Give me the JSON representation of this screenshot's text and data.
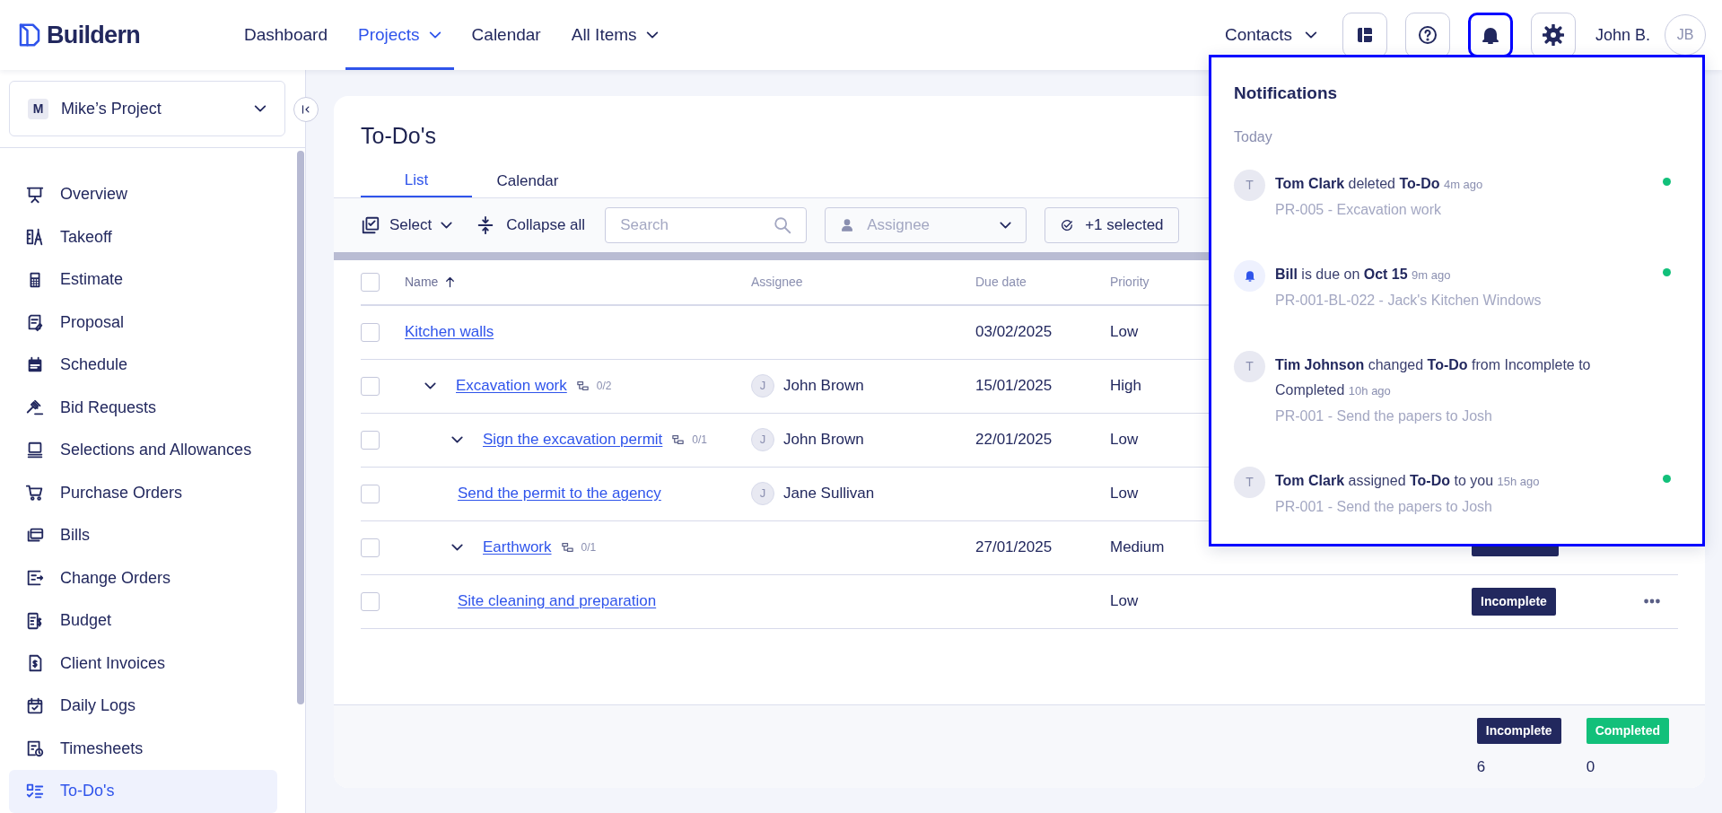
{
  "app": {
    "logo": "Buildern"
  },
  "nav": [
    {
      "label": "Dashboard",
      "selected": false,
      "dropdown": false
    },
    {
      "label": "Projects",
      "selected": true,
      "dropdown": true
    },
    {
      "label": "Calendar",
      "selected": false,
      "dropdown": false
    },
    {
      "label": "All Items",
      "selected": false,
      "dropdown": true
    }
  ],
  "header_right": {
    "contacts": "Contacts",
    "tools": [
      {
        "kind": "layout",
        "selected": false
      },
      {
        "kind": "help",
        "selected": false
      },
      {
        "kind": "notifications",
        "selected": true
      },
      {
        "kind": "settings",
        "selected": false
      }
    ],
    "user_name": "John B.",
    "user_initials": "JB"
  },
  "project": {
    "initial": "M",
    "name": "Mike’s Project"
  },
  "sidebar": {
    "items": [
      {
        "label": "Overview",
        "selected": false
      },
      {
        "label": "Takeoff",
        "selected": false
      },
      {
        "label": "Estimate",
        "selected": false
      },
      {
        "label": "Proposal",
        "selected": false
      },
      {
        "label": "Schedule",
        "selected": false
      },
      {
        "label": "Bid Requests",
        "selected": false
      },
      {
        "label": "Selections and Allowances",
        "selected": false
      },
      {
        "label": "Purchase Orders",
        "selected": false
      },
      {
        "label": "Bills",
        "selected": false
      },
      {
        "label": "Change Orders",
        "selected": false
      },
      {
        "label": "Budget",
        "selected": false
      },
      {
        "label": "Client Invoices",
        "selected": false
      },
      {
        "label": "Daily Logs",
        "selected": false
      },
      {
        "label": "Timesheets",
        "selected": false
      },
      {
        "label": "To-Do's",
        "selected": true
      }
    ]
  },
  "page": {
    "title": "To-Do's",
    "tabs": [
      {
        "label": "List",
        "selected": true
      },
      {
        "label": "Calendar",
        "selected": false
      }
    ],
    "toolbar": {
      "select": "Select",
      "collapse": "Collapse all",
      "search_placeholder": "Search",
      "assignee_placeholder": "Assignee",
      "status_filter": "+1 selected"
    },
    "table": {
      "select_all_checked": false,
      "columns": [
        {
          "label": "Name",
          "sorted": true
        },
        {
          "label": "Assignee",
          "sorted": false
        },
        {
          "label": "Due date",
          "sorted": false
        },
        {
          "label": "Priority",
          "sorted": false
        }
      ],
      "rows": [
        {
          "name": "Kitchen walls",
          "checked": false,
          "due_date": "03/02/2025",
          "priority": "Low",
          "menu": false
        },
        {
          "name": "Excavation work",
          "checked": false,
          "expanded": true,
          "subtasks": "0/2",
          "assignee": "John Brown",
          "assignee_initial": "J",
          "due_date": "15/01/2025",
          "priority": "High",
          "menu": false,
          "children": [
            {
              "name": "Sign the excavation permit",
              "checked": false,
              "expanded": true,
              "subtasks": "0/1",
              "assignee": "John Brown",
              "assignee_initial": "J",
              "due_date": "22/01/2025",
              "priority": "Low",
              "menu": false,
              "children": [
                {
                  "name": "Send the permit to the agency",
                  "checked": false,
                  "assignee": "Jane Sullivan",
                  "assignee_initial": "J",
                  "priority": "Low",
                  "menu": false
                }
              ]
            },
            {
              "name": "Earthwork",
              "checked": false,
              "expanded": true,
              "subtasks": "0/1",
              "due_date": "27/01/2025",
              "priority": "Medium",
              "status_badge": true,
              "menu": false,
              "children": [
                {
                  "name": "Site cleaning and preparation",
                  "checked": false,
                  "priority": "Low",
                  "status": "Incomplete",
                  "menu": true
                }
              ]
            }
          ]
        }
      ]
    },
    "summary": [
      {
        "label": "Incomplete",
        "count": "6",
        "color": "#22285e"
      },
      {
        "label": "Completed",
        "count": "0",
        "color": "#12c07a"
      }
    ]
  },
  "notifications": {
    "title": "Notifications",
    "group": "Today",
    "items": [
      {
        "kind": "letter",
        "initial": "T",
        "message": "**Tom Clark** deleted **To-Do**",
        "time": "4m ago",
        "detail": "PR-005 - Excavation work",
        "unread": true
      },
      {
        "kind": "bell",
        "message": "**Bill** is due on **Oct 15**",
        "time": "9m ago",
        "detail": "PR-001-BL-022 - Jack's Kitchen Windows",
        "unread": true
      },
      {
        "kind": "letter",
        "initial": "T",
        "message": "**Tim Johnson** changed **To-Do** from Incomplete to Completed",
        "time": "10h ago",
        "detail": "PR-001 - Send the papers to Josh",
        "unread": false
      },
      {
        "kind": "letter",
        "initial": "T",
        "message": "**Tom Clark** assigned **To-Do** to you",
        "time": "15h ago",
        "detail": "PR-001 - Send the papers to Josh",
        "unread": true
      }
    ]
  }
}
